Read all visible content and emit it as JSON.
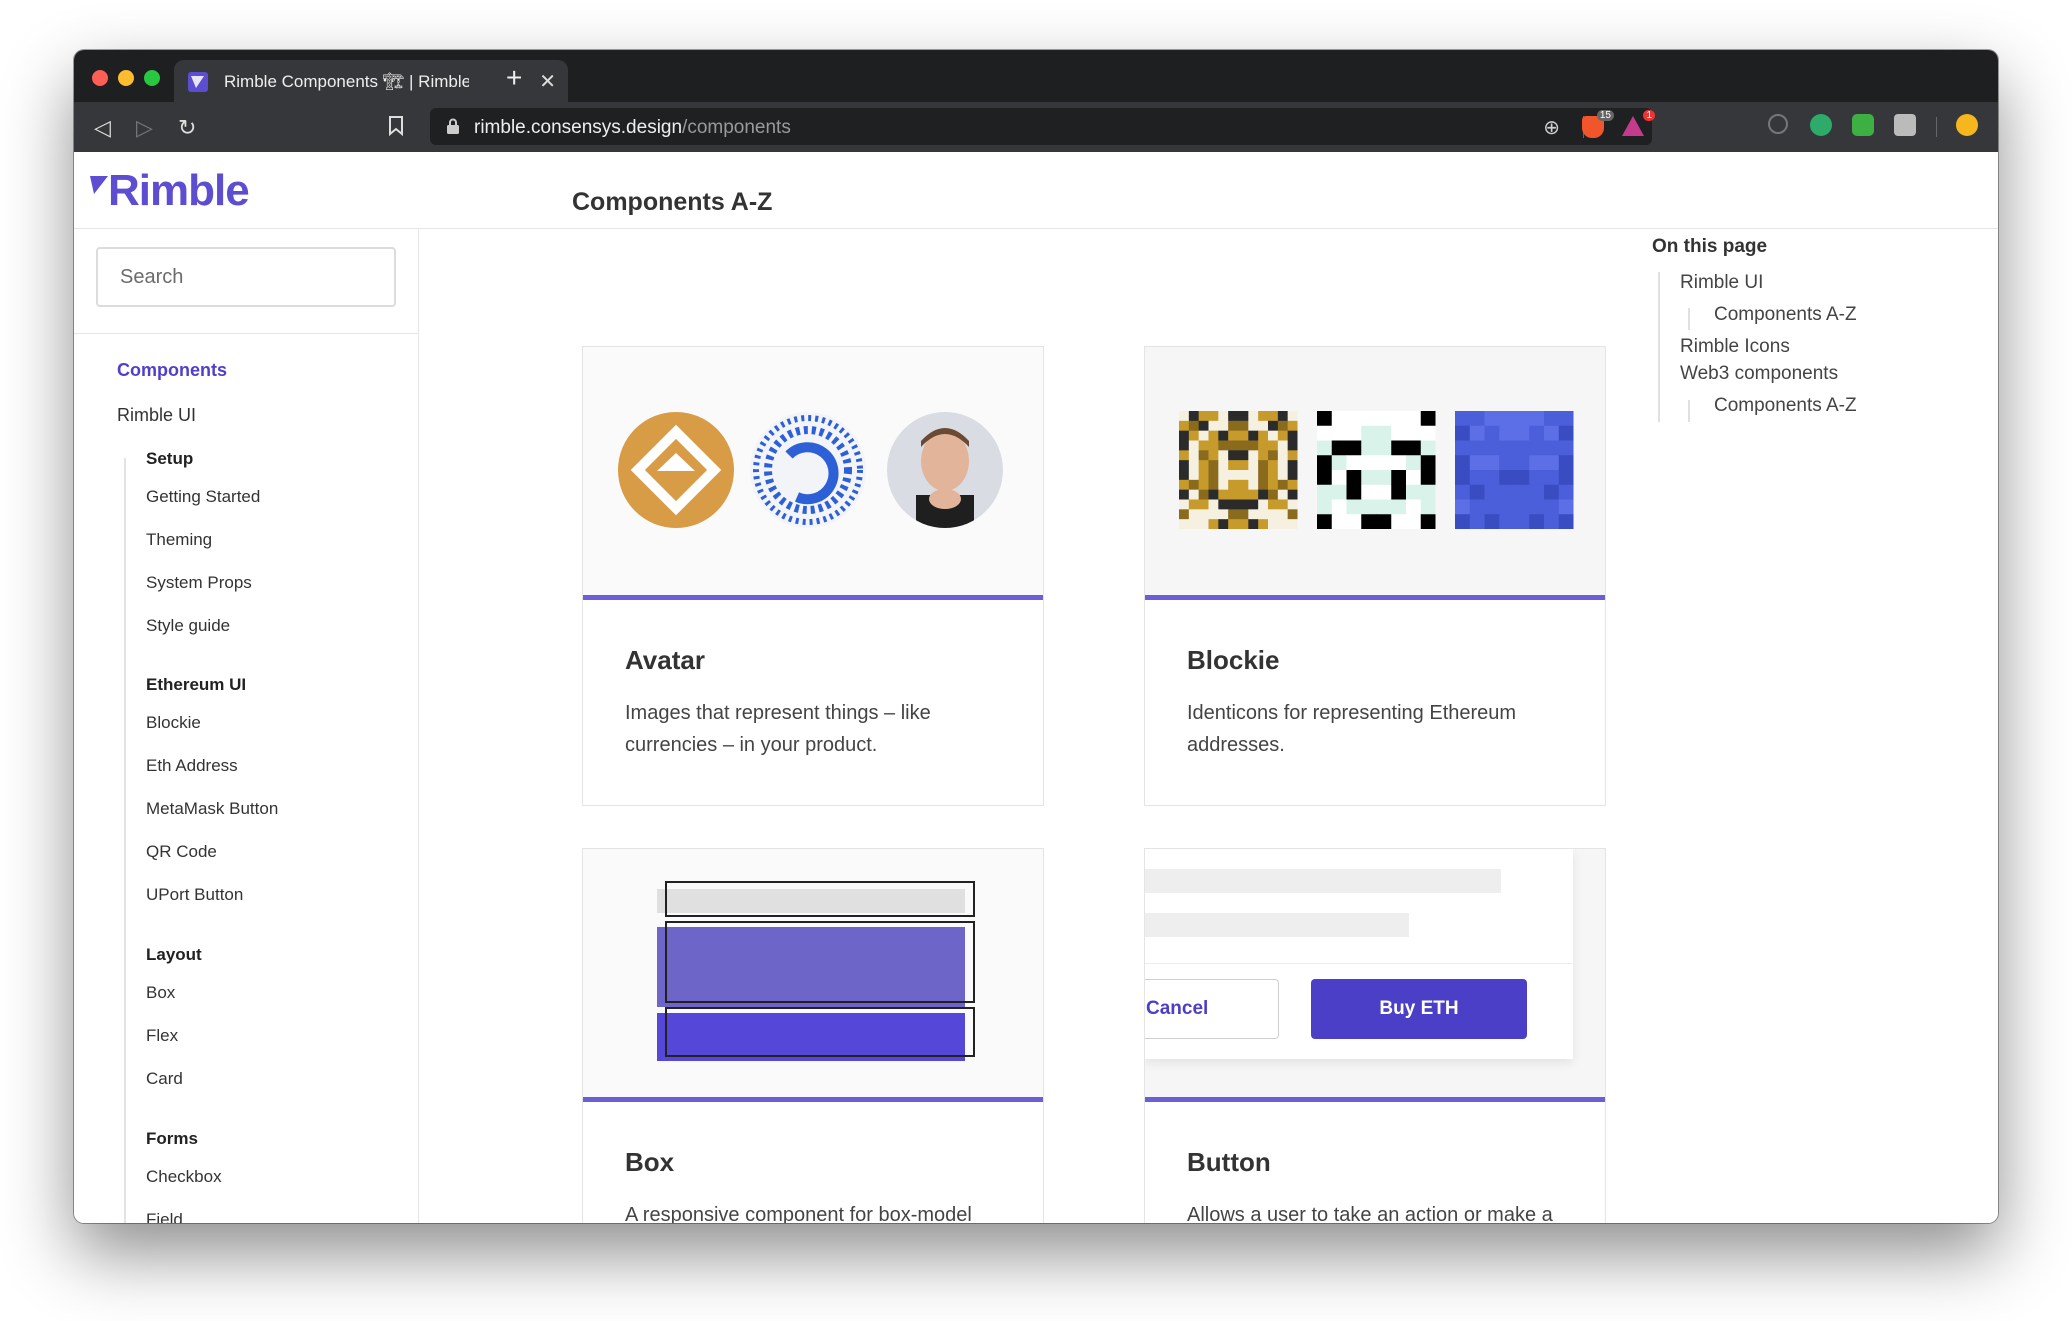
{
  "browser": {
    "tab_title": "Rimble Components 🏗 | Rimble",
    "url_host": "rimble.consensys.design",
    "url_path": "/components",
    "ext_badge_brave": "15",
    "ext_badge_alert": "1"
  },
  "logo": {
    "text": "Rimble"
  },
  "sidebar": {
    "search_placeholder": "Search",
    "components": "Components",
    "rimble_ui": "Rimble UI",
    "setup": "Setup",
    "setup_items": [
      "Getting Started",
      "Theming",
      "System Props",
      "Style guide"
    ],
    "ethereum_ui": "Ethereum UI",
    "ethereum_items": [
      "Blockie",
      "Eth Address",
      "MetaMask Button",
      "QR Code",
      "UPort Button"
    ],
    "layout": "Layout",
    "layout_items": [
      "Box",
      "Flex",
      "Card"
    ],
    "forms": "Forms",
    "forms_items": [
      "Checkbox",
      "Field"
    ]
  },
  "main": {
    "title": "Components A-Z",
    "cards": [
      {
        "title": "Avatar",
        "desc": "Images that represent things – like currencies – in your product."
      },
      {
        "title": "Blockie",
        "desc": "Identicons for representing Ethereum addresses."
      },
      {
        "title": "Box",
        "desc": "A responsive component for box-model"
      },
      {
        "title": "Button",
        "desc": "Allows a user to take an action or make a"
      }
    ],
    "button_preview": {
      "cancel": "Cancel",
      "buy": "Buy ETH"
    }
  },
  "toc": {
    "title": "On this page",
    "items": [
      "Rimble UI",
      "Components A-Z",
      "Rimble Icons",
      "Web3 components",
      "Components A-Z"
    ]
  },
  "colors": {
    "brand": "#5d4dd0",
    "accent_bar": "#6c5fd6",
    "buy_button": "#4b3fc8"
  }
}
